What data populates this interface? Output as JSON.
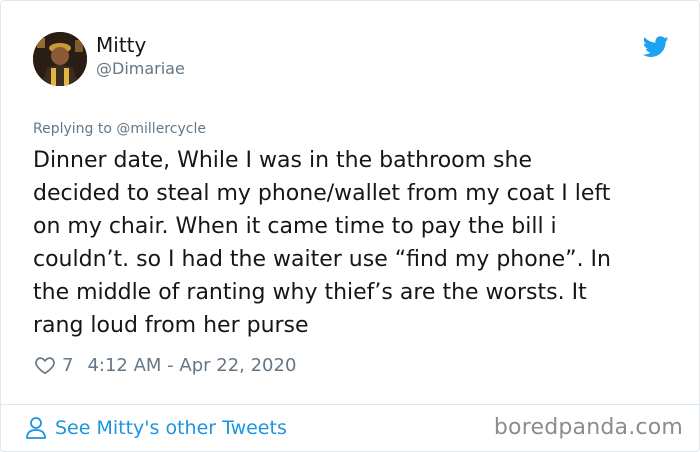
{
  "tweet": {
    "author_name": "Mitty",
    "author_handle": "@Dimariae",
    "replying_prefix": "Replying to ",
    "replying_to": "@millercycle",
    "text": "Dinner date, While I was in the bathroom she\ndecided to steal my phone/wallet from my coat I left\non my chair. When it came time to pay the bill i\ncouldn’t. so I had the waiter use “find my phone”. In\nthe middle of ranting why thief’s are the worsts. It\nrang loud from her purse",
    "likes": "7",
    "timestamp": "4:12 AM - Apr 22, 2020"
  },
  "footer": {
    "see_more_label": "See Mitty's other Tweets",
    "watermark": "boredpanda.com"
  },
  "icons": {
    "brand": "twitter-bird-icon",
    "like": "heart-icon",
    "profile": "person-icon"
  },
  "colors": {
    "twitter_blue": "#1da1f2",
    "link_blue": "#1b95e0",
    "secondary_text": "#657786",
    "border": "#e1e8ed"
  }
}
